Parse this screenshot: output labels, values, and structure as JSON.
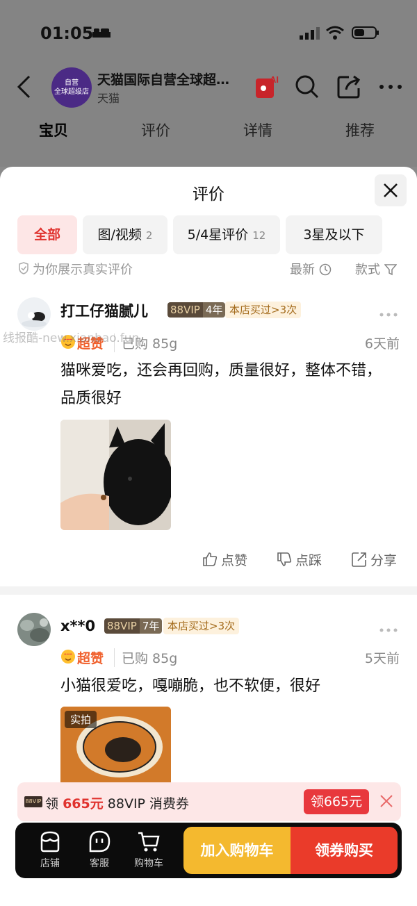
{
  "status_bar": {
    "time": "01:05"
  },
  "shop": {
    "name": "天猫国际自营全球超…",
    "subtitle": "天猫",
    "logo_line1": "自营",
    "logo_line2": "全球超级店"
  },
  "ai_label": "AI",
  "page_tabs": [
    "宝贝",
    "评价",
    "详情",
    "推荐"
  ],
  "sheet": {
    "title": "评价",
    "filters": [
      {
        "label": "全部",
        "count": ""
      },
      {
        "label": "图/视频",
        "count": "2"
      },
      {
        "label": "5/4星评价",
        "count": "12"
      },
      {
        "label": "3星及以下",
        "count": ""
      }
    ],
    "notice": "为你展示真实评价",
    "sort_label": "最新",
    "style_label": "款式"
  },
  "reviews": [
    {
      "user": "打工仔猫腻儿",
      "vip": "88VIP",
      "years": "4年",
      "repeat_badge": "本店买过>3次",
      "rating": "超赞",
      "bought": "已购 85g",
      "ago": "6天前",
      "text": "猫咪爱吃，还会再回购，质量很好，整体不错，品质很好",
      "actions": {
        "like": "点赞",
        "dislike": "点踩",
        "share": "分享"
      }
    },
    {
      "user": "x**0",
      "vip": "88VIP",
      "years": "7年",
      "repeat_badge": "本店买过>3次",
      "rating": "超赞",
      "bought": "已购 85g",
      "ago": "5天前",
      "text": "小猫很爱吃，嘎嘣脆，也不软便，很好",
      "photo_tag": "实拍"
    }
  ],
  "coupon": {
    "prefix": "领",
    "amount": "665元",
    "suffix": "88VIP 消费券",
    "button": "领665元",
    "vip_mark": "88VIP"
  },
  "action_bar": {
    "store": "店铺",
    "service": "客服",
    "cart": "购物车",
    "add_cart": "加入购物车",
    "buy": "领券购买"
  },
  "watermark": "线报酷-new.xianbao.fun",
  "colors": {
    "accent_red": "#e0322e",
    "cart_yellow": "#f4b92f",
    "buy_red": "#ea3b2a",
    "rating_orange": "#f0602c"
  }
}
